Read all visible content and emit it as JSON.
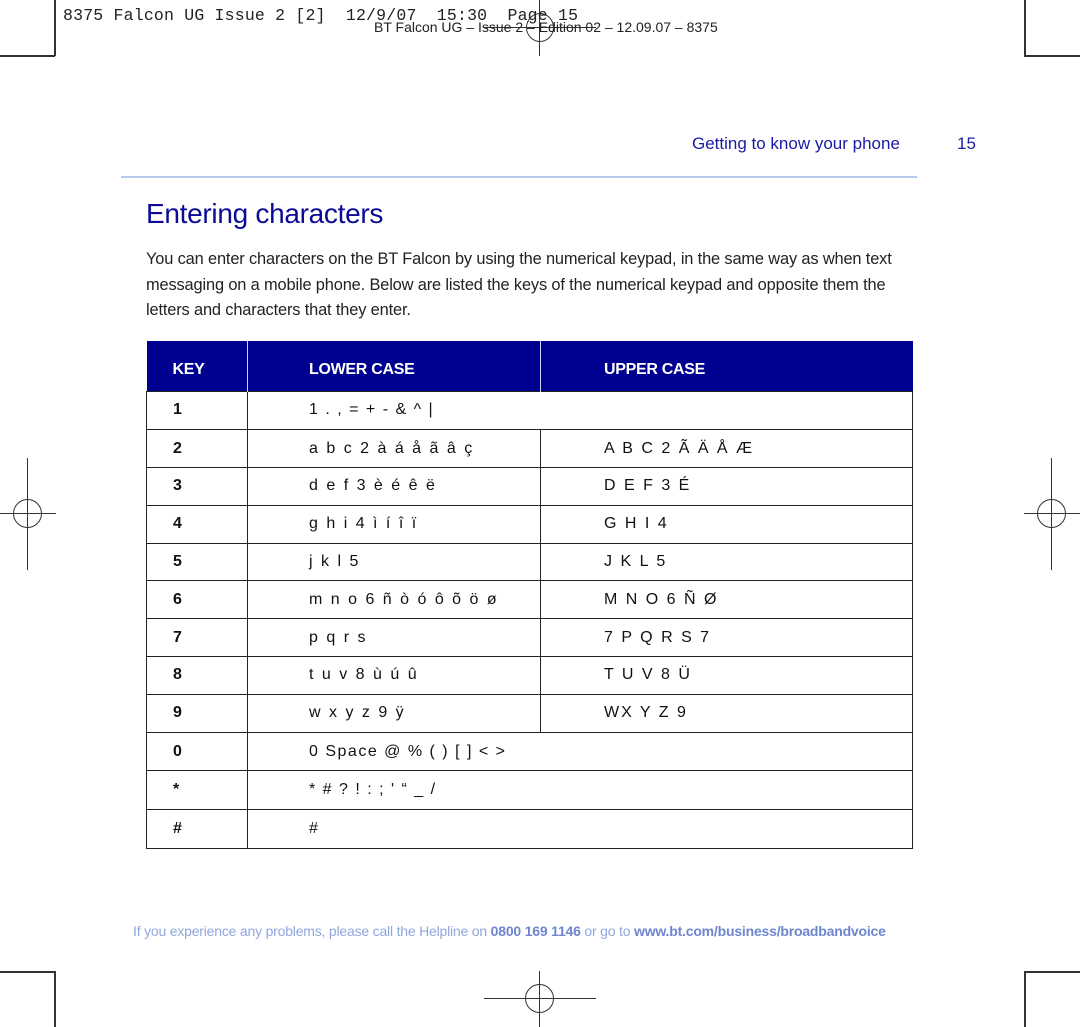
{
  "slug": {
    "print_line": "8375 Falcon UG Issue 2 [2]  12/9/07  15:30  Page 15",
    "edition_line": "BT Falcon UG – Issue 2 – Edition 02 – 12.09.07 – 8375"
  },
  "header": {
    "running_head": "Getting to know your phone",
    "page_number": "15"
  },
  "main": {
    "title": "Entering characters",
    "intro": "You can enter characters on the BT Falcon by using the numerical keypad, in the same way as when text messaging on a mobile phone. Below are listed the keys of the numerical keypad and opposite them the letters and characters that they enter."
  },
  "table": {
    "columns": [
      "KEY",
      "LOWER CASE",
      "UPPER CASE"
    ],
    "colors": {
      "header_bg": "#000090",
      "header_text": "#ffffff"
    },
    "rows": [
      {
        "key": "1",
        "lower": "1 . , = + - & ^ |",
        "upper": null
      },
      {
        "key": "2",
        "lower": "a b c 2 à á å ã â ç",
        "upper": "A B C 2 Ã Ä Å Æ"
      },
      {
        "key": "3",
        "lower": "d e f 3 è é ê ë",
        "upper": "D E F 3 É"
      },
      {
        "key": "4",
        "lower": "g h i 4 ì í î ï",
        "upper": "G H I 4"
      },
      {
        "key": "5",
        "lower": "j k l 5",
        "upper": "J K L 5"
      },
      {
        "key": "6",
        "lower": "m n o 6 ñ ò ó ô õ ö ø",
        "upper": "M N O 6 Ñ Ø"
      },
      {
        "key": "7",
        "lower": "p q r s",
        "upper": "7 P Q R S 7"
      },
      {
        "key": "8",
        "lower": "t u v 8 ù ú û",
        "upper": "T U V 8 Ü"
      },
      {
        "key": "9",
        "lower": "w x y z 9 ÿ",
        "upper": "WX Y Z 9"
      },
      {
        "key": "0",
        "lower": "0 Space @ % ( ) [ ] < >",
        "upper": null
      },
      {
        "key": "*",
        "lower": "* # ? ! : ; ' “ _ /",
        "upper": null
      },
      {
        "key": "#",
        "lower": "#",
        "upper": null
      }
    ]
  },
  "footer": {
    "text_before": "If you experience any problems, please call the Helpline on ",
    "phone": "0800 169 1146",
    "text_middle": " or go to ",
    "url": "www.bt.com/business/broadbandvoice"
  }
}
